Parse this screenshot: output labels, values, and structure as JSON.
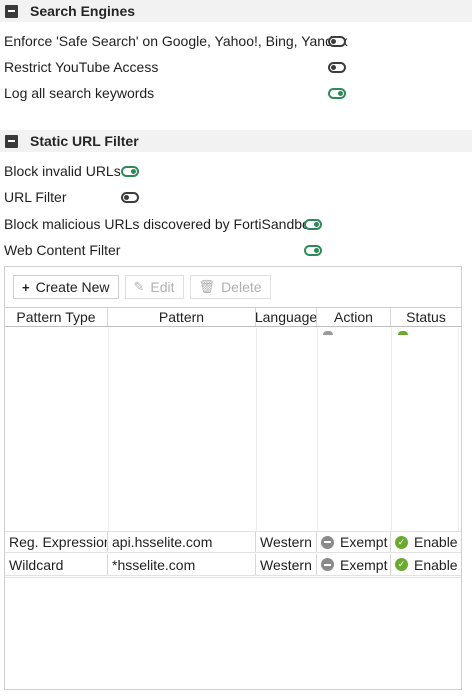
{
  "search_engines": {
    "title": "Search Engines",
    "options": [
      {
        "label": "Enforce 'Safe Search' on Google, Yahoo!, Bing, Yandex",
        "enabled": false
      },
      {
        "label": "Restrict YouTube Access",
        "enabled": false
      },
      {
        "label": "Log all search keywords",
        "enabled": true
      }
    ]
  },
  "static_url_filter": {
    "title": "Static URL Filter",
    "options": [
      {
        "label": "Block invalid URLs",
        "enabled": true
      },
      {
        "label": "URL Filter",
        "enabled": false
      },
      {
        "label": "Block malicious URLs discovered by FortiSandbox",
        "enabled": true
      },
      {
        "label": "Web Content Filter",
        "enabled": true
      }
    ]
  },
  "toolbar": {
    "create_new": "Create New",
    "edit": "Edit",
    "delete": "Delete"
  },
  "table": {
    "columns": [
      "Pattern Type",
      "Pattern",
      "Language",
      "Action",
      "Status"
    ],
    "rows": [
      {
        "pattern_type": "Reg. Expression",
        "pattern": "api.hsselite.com",
        "language": "Western",
        "action": "Exempt",
        "status": "Enable"
      },
      {
        "pattern_type": "Wildcard",
        "pattern": "*hsselite.com",
        "language": "Western",
        "action": "Exempt",
        "status": "Enable"
      }
    ]
  },
  "colors": {
    "toggle_on": "#2e8b57",
    "toggle_off": "#3c3c3c",
    "enable_icon": "#6aab2e",
    "exempt_icon": "#8a8a8a"
  }
}
